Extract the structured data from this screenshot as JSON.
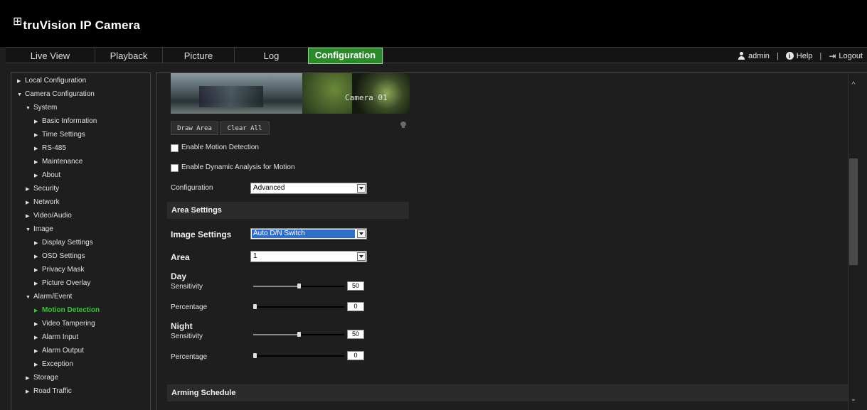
{
  "app": {
    "logo_mark": "⊞",
    "title": "truVision IP Camera"
  },
  "nav": {
    "tabs": [
      {
        "label": "Live View"
      },
      {
        "label": "Playback"
      },
      {
        "label": "Picture"
      },
      {
        "label": "Log"
      },
      {
        "label": "Configuration",
        "active": true
      }
    ],
    "user": "admin",
    "help": "Help",
    "logout": "Logout"
  },
  "sidebar": {
    "items": [
      {
        "label": "Local Configuration"
      },
      {
        "label": "Camera Configuration"
      },
      {
        "label": "System"
      },
      {
        "label": "Basic Information"
      },
      {
        "label": "Time Settings"
      },
      {
        "label": "RS-485"
      },
      {
        "label": "Maintenance"
      },
      {
        "label": "About"
      },
      {
        "label": "Security"
      },
      {
        "label": "Network"
      },
      {
        "label": "Video/Audio"
      },
      {
        "label": "Image"
      },
      {
        "label": "Display Settings"
      },
      {
        "label": "OSD Settings"
      },
      {
        "label": "Privacy Mask"
      },
      {
        "label": "Picture Overlay"
      },
      {
        "label": "Alarm/Event"
      },
      {
        "label": "Motion Detection",
        "active": true
      },
      {
        "label": "Video Tampering"
      },
      {
        "label": "Alarm Input"
      },
      {
        "label": "Alarm Output"
      },
      {
        "label": "Exception"
      },
      {
        "label": "Storage"
      },
      {
        "label": "Road Traffic"
      }
    ]
  },
  "main": {
    "camera_label": "Camera 01",
    "draw_area_label": "Draw Area",
    "clear_all_label": "Clear All",
    "enable_motion_label": "Enable Motion Detection",
    "enable_motion_checked": false,
    "enable_dynamic_label": "Enable Dynamic Analysis for Motion",
    "enable_dynamic_checked": false,
    "configuration_label": "Configuration",
    "configuration_value": "Advanced",
    "area_settings_title": "Area Settings",
    "image_settings_label": "Image Settings",
    "image_settings_value": "Auto D/N Switch",
    "area_label": "Area",
    "area_value": "1",
    "day": {
      "title": "Day",
      "sensitivity_label": "Sensitivity",
      "sensitivity_value": "50",
      "sensitivity_fraction": 0.5,
      "percentage_label": "Percentage",
      "percentage_value": "0",
      "percentage_fraction": 0
    },
    "night": {
      "title": "Night",
      "sensitivity_label": "Sensitivity",
      "sensitivity_value": "50",
      "sensitivity_fraction": 0.5,
      "percentage_label": "Percentage",
      "percentage_value": "0",
      "percentage_fraction": 0
    },
    "arming_schedule_title": "Arming Schedule"
  },
  "colors": {
    "accent": "#2c8a2c",
    "active_text": "#37c837",
    "background": "#1e1e1e",
    "header": "#000000"
  }
}
